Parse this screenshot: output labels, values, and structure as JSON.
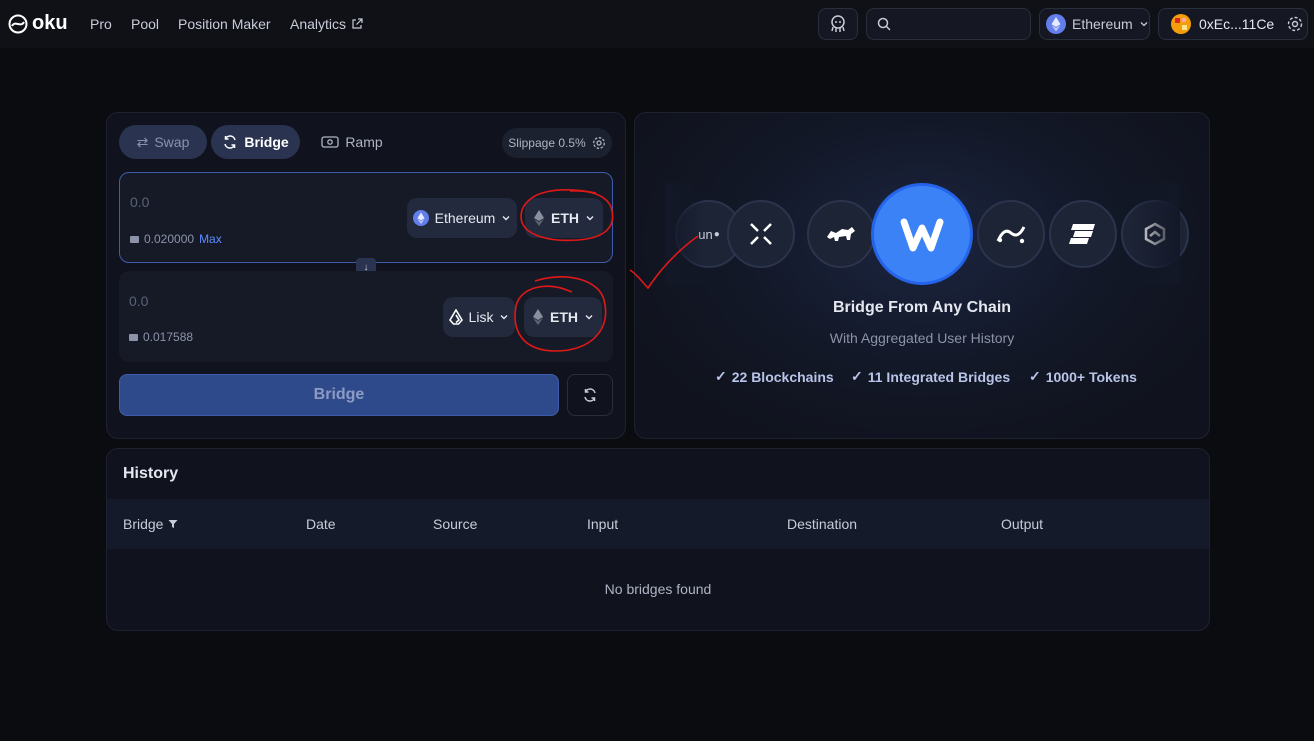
{
  "colors": {
    "background": "#0b0c10",
    "card": "#10131d",
    "accent_blue": "#3b82f6",
    "annotation_red": "#e01818",
    "max_link": "#5b8cff"
  },
  "nav": {
    "logo_text": "oku",
    "links": [
      "Pro",
      "Pool",
      "Position Maker",
      "Analytics"
    ],
    "chain": "Ethereum",
    "wallet": "0xEc...11Ce",
    "search_placeholder": ""
  },
  "tabs": {
    "swap": "Swap",
    "bridge": "Bridge",
    "ramp": "Ramp"
  },
  "slippage": "Slippage 0.5%",
  "from": {
    "amount": "0.0",
    "balance": "0.020000",
    "max_label": "Max",
    "chain": "Ethereum",
    "token": "ETH"
  },
  "to": {
    "amount": "0.0",
    "balance": "0.017588",
    "chain": "Lisk",
    "token": "ETH"
  },
  "bridge_button": "Bridge",
  "promo": {
    "title": "Bridge From Any Chain",
    "subtitle": "With Aggregated User History",
    "features": [
      "22 Blockchains",
      "11 Integrated Bridges",
      "1000+ Tokens"
    ],
    "logo_left_text": "un"
  },
  "history": {
    "title": "History",
    "columns": [
      "Bridge",
      "Date",
      "Source",
      "Input",
      "Destination",
      "Output"
    ],
    "empty_text": "No bridges found"
  }
}
